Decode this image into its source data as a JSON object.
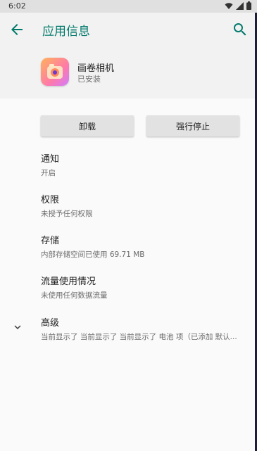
{
  "status_bar": {
    "time": "6:02"
  },
  "app_bar": {
    "title": "应用信息",
    "back_icon": "arrow-back-icon",
    "search_icon": "search-icon"
  },
  "app": {
    "name": "画卷相机",
    "status": "已安装"
  },
  "buttons": {
    "uninstall": "卸载",
    "force_stop": "强行停止"
  },
  "settings": [
    {
      "title": "通知",
      "subtitle": "开启"
    },
    {
      "title": "权限",
      "subtitle": "未授予任何权限"
    },
    {
      "title": "存储",
      "subtitle": "内部存储空间已使用 69.71 MB"
    },
    {
      "title": "流量使用情况",
      "subtitle": "未使用任何数据流量"
    },
    {
      "title": "高级",
      "subtitle": "当前显示了 当前显示了 当前显示了 电池 项（已添加 默认..."
    }
  ],
  "colors": {
    "accent": "#00796b",
    "header_bg": "#f2f2f2",
    "button_bg": "#e2e2e2"
  }
}
